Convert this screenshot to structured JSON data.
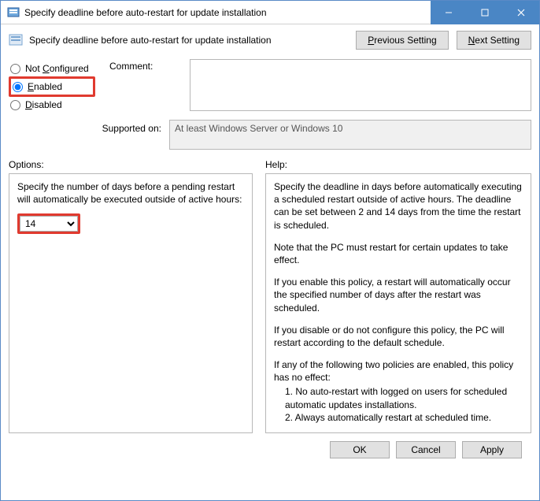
{
  "window": {
    "title": "Specify deadline before auto-restart for update installation"
  },
  "header": {
    "title": "Specify deadline before auto-restart for update installation",
    "prev_label": "Previous Setting",
    "next_label": "Next Setting"
  },
  "config": {
    "not_configured_label": "Not Configured",
    "enabled_label": "Enabled",
    "disabled_label": "Disabled",
    "selected": "enabled",
    "comment_label": "Comment:",
    "comment_value": "",
    "supported_label": "Supported on:",
    "supported_value": "At least Windows Server or Windows 10"
  },
  "sections": {
    "options_label": "Options:",
    "help_label": "Help:"
  },
  "options": {
    "description": "Specify the number of days before a pending restart will automatically be executed outside of active hours:",
    "days_value": "14"
  },
  "help": {
    "p1": "Specify the deadline in days before automatically executing a scheduled restart outside of active hours. The deadline can be set between 2 and 14 days from the time the restart is scheduled.",
    "p2": "Note that the PC must restart for certain updates to take effect.",
    "p3": "If you enable this policy, a restart will automatically occur the specified number of days after the restart was scheduled.",
    "p4": "If you disable or do not configure this policy, the PC will restart according to the default schedule.",
    "p5": "If any of the following two policies are enabled, this policy has no effect:",
    "p5a": "1. No auto-restart with logged on users for scheduled automatic updates installations.",
    "p5b": "2. Always automatically restart at scheduled time."
  },
  "footer": {
    "ok": "OK",
    "cancel": "Cancel",
    "apply": "Apply"
  }
}
